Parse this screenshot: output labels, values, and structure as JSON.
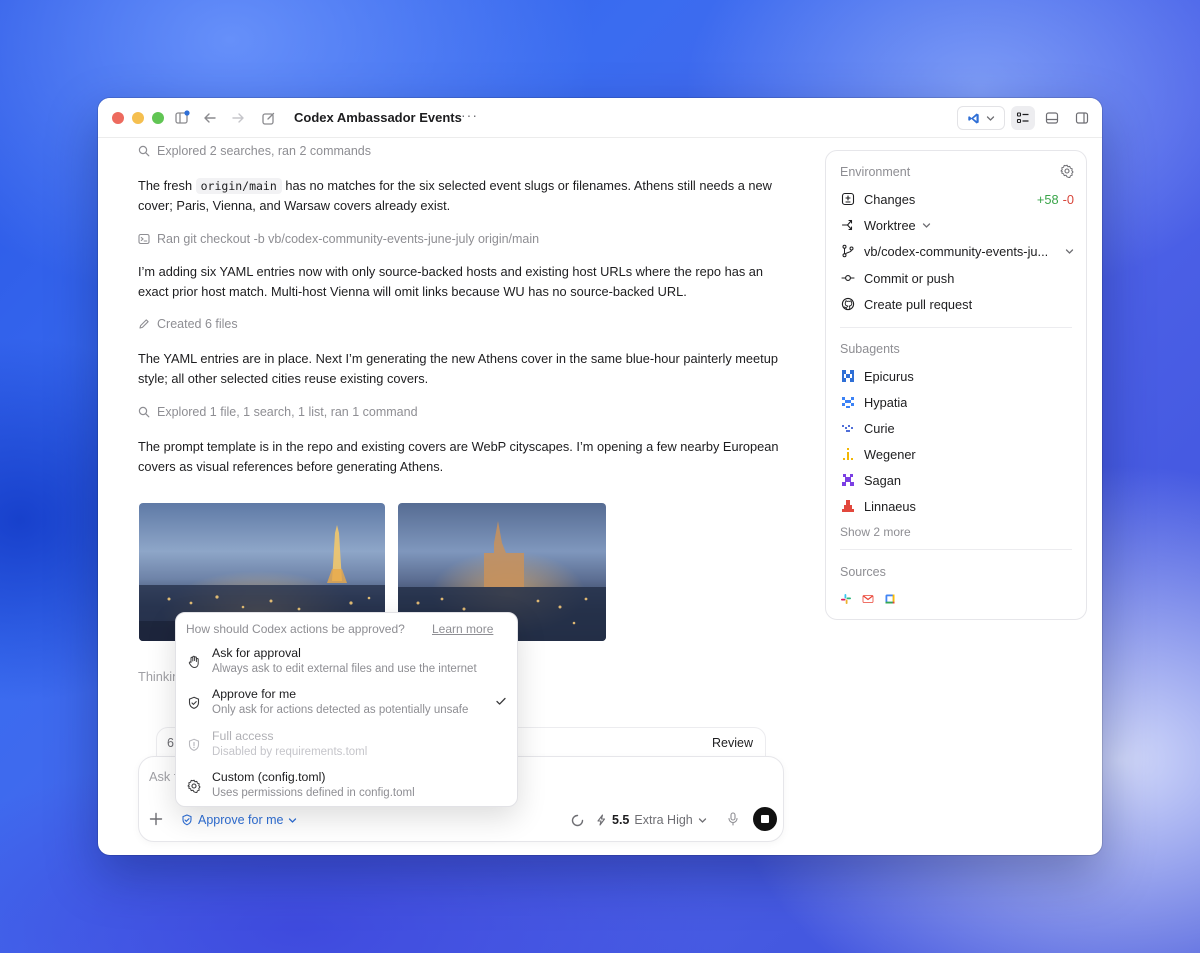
{
  "window": {
    "title": "Codex Ambassador Events",
    "more": "···"
  },
  "transcript": {
    "meta1": "Explored 2 searches, ran 2 commands",
    "para1_a": "The fresh ",
    "para1_code": "origin/main",
    "para1_b": " has no matches for the six selected event slugs or filenames. Athens still needs a new cover; Paris, Vienna, and Warsaw covers already exist.",
    "meta2": "Ran git checkout -b vb/codex-community-events-june-july origin/main",
    "para2": "I’m adding six YAML entries now with only source-backed hosts and existing host URLs where the repo has an exact prior host match. Multi-host Vienna will omit links because WU has no source-backed URL.",
    "meta3": "Created 6 files",
    "para3": "The YAML entries are in place. Next I’m generating the new Athens cover in the same blue-hour painterly meetup style; all other selected cities reuse existing covers.",
    "meta4": "Explored 1 file, 1 search, 1 list, ran 1 command",
    "para4": "The prompt template is in the repo and existing covers are WebP cityscapes. I’m opening a few nearby European covers as visual references before generating Athens.",
    "thinking": "Thinking"
  },
  "review": {
    "left": "6",
    "right": "Review"
  },
  "composer": {
    "placeholder": "Ask f",
    "approve_label": "Approve for me",
    "model_version": "5.5",
    "model_effort": "Extra High"
  },
  "popup": {
    "question": "How should Codex actions be approved?",
    "learn_more": "Learn more",
    "options": [
      {
        "title": "Ask for approval",
        "subtitle": "Always ask to edit external files and use the internet"
      },
      {
        "title": "Approve for me",
        "subtitle": "Only ask for actions detected as potentially unsafe"
      },
      {
        "title": "Full access",
        "subtitle": "Disabled by requirements.toml"
      },
      {
        "title": "Custom (config.toml)",
        "subtitle": "Uses permissions defined in config.toml"
      }
    ]
  },
  "sidebar": {
    "environment_heading": "Environment",
    "changes_label": "Changes",
    "changes_plus": "+58",
    "changes_minus": "-0",
    "worktree_label": "Worktree",
    "branch_label": "vb/codex-community-events-ju...",
    "commit_label": "Commit or push",
    "pr_label": "Create pull request",
    "subagents_heading": "Subagents",
    "subagents": [
      {
        "name": "Epicurus",
        "color": "#2f6fd6"
      },
      {
        "name": "Hypatia",
        "color": "#3b82f6"
      },
      {
        "name": "Curie",
        "color": "#4f6ed8"
      },
      {
        "name": "Wegener",
        "color": "#f2b705"
      },
      {
        "name": "Sagan",
        "color": "#7b3fe4"
      },
      {
        "name": "Linnaeus",
        "color": "#e2483d"
      }
    ],
    "show_more": "Show 2 more",
    "sources_heading": "Sources"
  },
  "colors": {
    "accent": "#2f6fd6",
    "added": "#3aa54a",
    "removed": "#d8453a"
  }
}
